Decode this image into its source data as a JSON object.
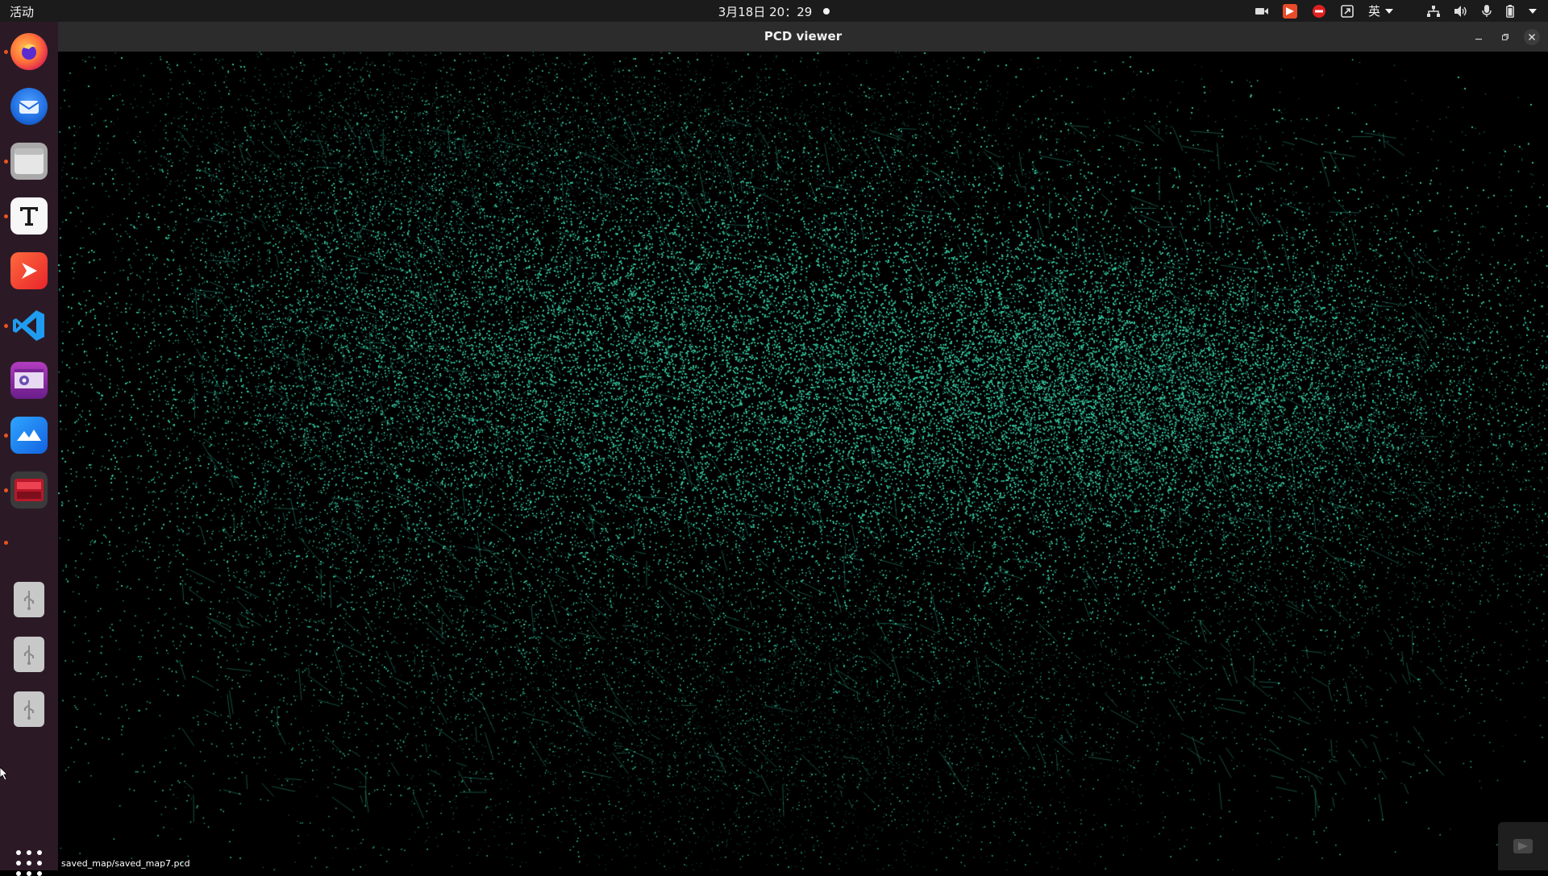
{
  "topbar": {
    "activities_label": "活动",
    "clock": "3月18日  20：29",
    "ime_label": "英",
    "tray_icons": [
      "camera-icon",
      "wps-icon",
      "do-not-disturb-icon",
      "update-icon",
      "ime-icon",
      "network-icon",
      "volume-icon",
      "microphone-icon",
      "battery-icon",
      "system-menu-icon"
    ]
  },
  "dock": {
    "items": [
      {
        "name": "firefox",
        "icon": "firefox-icon",
        "running": true
      },
      {
        "name": "thunderbird",
        "icon": "thunderbird-icon",
        "running": false
      },
      {
        "name": "files",
        "icon": "files-icon",
        "running": true
      },
      {
        "name": "text-editor",
        "icon": "text-editor-icon",
        "running": true
      },
      {
        "name": "wps-office",
        "icon": "wps-icon",
        "running": false
      },
      {
        "name": "vscode",
        "icon": "vscode-icon",
        "running": true
      },
      {
        "name": "video-app",
        "icon": "video-icon",
        "running": false
      },
      {
        "name": "feishu",
        "icon": "feishu-icon",
        "running": true
      },
      {
        "name": "terminal-app",
        "icon": "red-terminal-icon",
        "running": true
      },
      {
        "name": "usb-drive-1",
        "icon": "usb-drive-icon",
        "running": false
      },
      {
        "name": "usb-drive-2",
        "icon": "usb-drive-icon",
        "running": false
      },
      {
        "name": "usb-drive-3",
        "icon": "usb-drive-icon",
        "running": false
      }
    ],
    "show_apps_icon": "apps-grid-icon"
  },
  "window": {
    "title": "PCD viewer",
    "status_text": "saved_map/saved_map7.pcd",
    "point_color": "#38c7a0",
    "background_color": "#000000"
  },
  "colors": {
    "topbar_bg": "#1b1b1b",
    "dock_bg": "#2b1a26",
    "accent": "#e95420",
    "titlebar_bg": "#2c2c2c"
  }
}
